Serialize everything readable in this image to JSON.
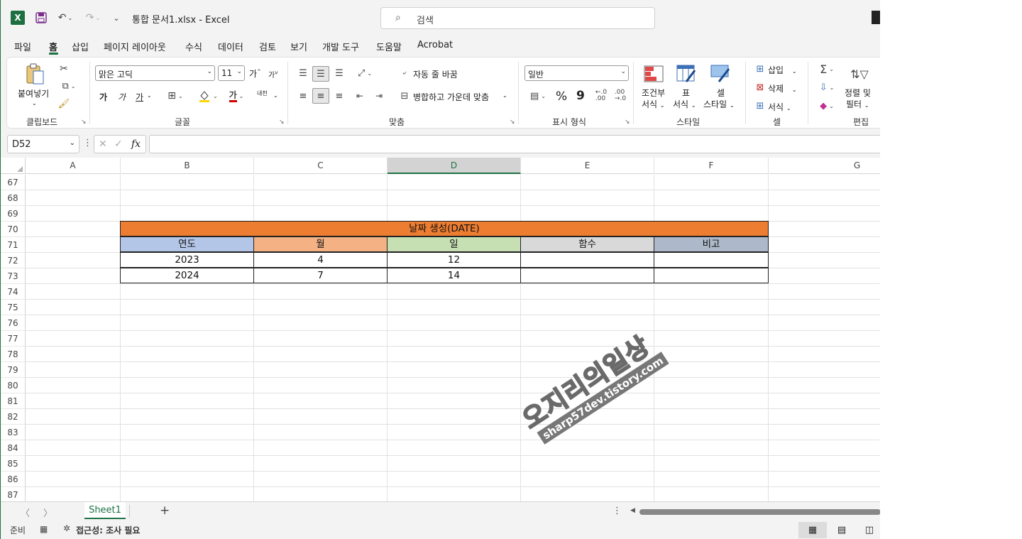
{
  "titlebar": {
    "app_icon": "X",
    "doc_title": "통합 문서1.xlsx  -  Excel",
    "search_placeholder": "검색"
  },
  "menu": [
    "파일",
    "홈",
    "삽입",
    "페이지 레이아웃",
    "수식",
    "데이터",
    "검토",
    "보기",
    "개발 도구",
    "도움말",
    "Acrobat"
  ],
  "active_menu": "홈",
  "ribbon": {
    "clipboard": {
      "paste": "붙여넣기",
      "label": "클립보드"
    },
    "font": {
      "name": "맑은 고딕",
      "size": "11",
      "grow": "가",
      "shrink": "가",
      "bold": "가",
      "italic": "가",
      "underline": "가",
      "color_glyph": "가",
      "phonetic": "내천",
      "label": "글꼴",
      "fill_color": "#ffd700",
      "font_color": "#d00000"
    },
    "align": {
      "wrap": "자동 줄 바꿈",
      "merge": "병합하고 가운데 맞춤",
      "label": "맞춤"
    },
    "number": {
      "format": "일반",
      "percent": "%",
      "comma": "9",
      "label": "표시 형식"
    },
    "styles": {
      "cond1": "조건부",
      "cond2": "서식",
      "table1": "표",
      "table2": "서식",
      "cell1": "셀",
      "cell2": "스타일",
      "label": "스타일"
    },
    "cells": {
      "insert": "삽입",
      "delete": "삭제",
      "format": "서식",
      "label": "셀"
    },
    "editing": {
      "sort1": "정렬 및",
      "sort2": "필터",
      "label": "편집"
    }
  },
  "formula_bar": {
    "name_box": "D52",
    "fx": "fx",
    "value": ""
  },
  "columns": [
    "A",
    "B",
    "C",
    "D",
    "E",
    "F",
    "G"
  ],
  "selected_column": "D",
  "rows": [
    "67",
    "68",
    "69",
    "70",
    "71",
    "72",
    "73",
    "74",
    "75",
    "76",
    "77",
    "78",
    "79",
    "80",
    "81",
    "82",
    "83",
    "84",
    "85",
    "86",
    "87"
  ],
  "table": {
    "title": "날짜 생성(DATE)",
    "headers": [
      "연도",
      "월",
      "일",
      "함수",
      "비고"
    ],
    "data": [
      [
        "2023",
        "4",
        "12",
        "",
        ""
      ],
      [
        "2024",
        "7",
        "14",
        "",
        ""
      ]
    ],
    "colors": {
      "title": "#ed7d31",
      "header": [
        "#b4c6e7",
        "#f4b183",
        "#c6e0b4",
        "#d9d9d9",
        "#adb9ca"
      ]
    }
  },
  "watermark": {
    "main": "오지리의일상",
    "sub": "sharp57dev.tistory.com"
  },
  "sheets": {
    "active": "Sheet1",
    "add": "+"
  },
  "statusbar": {
    "ready": "준비",
    "accessibility": "접근성: 조사 필요"
  }
}
